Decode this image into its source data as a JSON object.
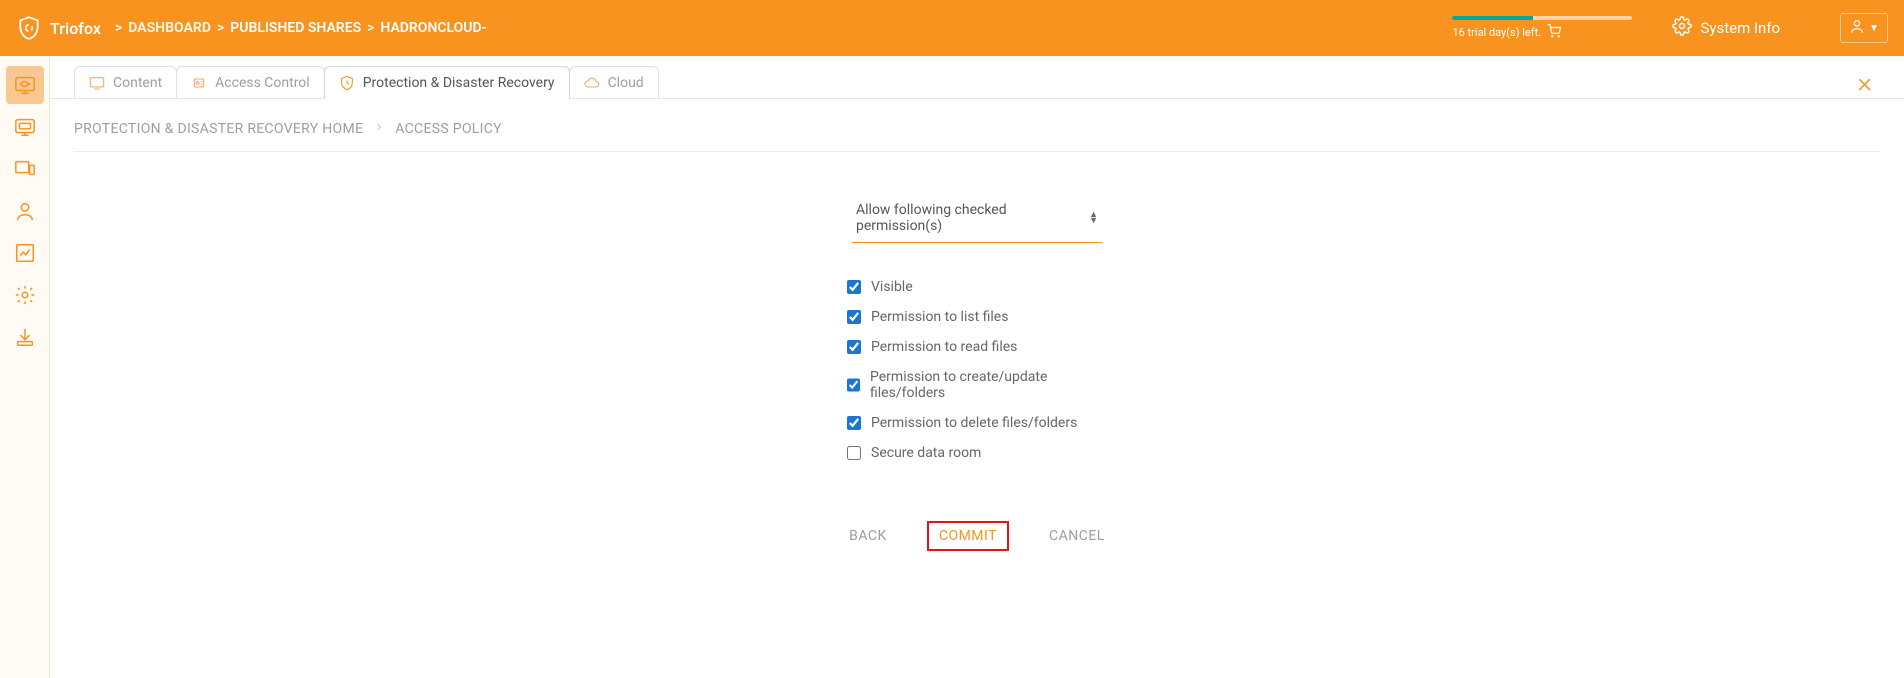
{
  "header": {
    "brand": "Triofox",
    "crumbs": {
      "dashboard": "DASHBOARD",
      "published": "PUBLISHED SHARES",
      "target": "HADRONCLOUD-"
    },
    "trial_text": "16 trial day(s) left.",
    "system_info": "System Info"
  },
  "tabs": {
    "content": "Content",
    "access": "Access Control",
    "protection": "Protection & Disaster Recovery",
    "cloud": "Cloud"
  },
  "sub_crumbs": {
    "home": "PROTECTION & DISASTER RECOVERY HOME",
    "current": "ACCESS POLICY"
  },
  "dropdown_label": "Allow following checked permission(s)",
  "permissions": [
    {
      "label": "Visible",
      "checked": true
    },
    {
      "label": "Permission to list files",
      "checked": true
    },
    {
      "label": "Permission to read files",
      "checked": true
    },
    {
      "label": "Permission to create/update files/folders",
      "checked": true
    },
    {
      "label": "Permission to delete files/folders",
      "checked": true
    },
    {
      "label": "Secure data room",
      "checked": false
    }
  ],
  "buttons": {
    "back": "BACK",
    "commit": "COMMIT",
    "cancel": "CANCEL"
  },
  "colors": {
    "accent": "#f7931e",
    "highlight_border": "#e81313"
  }
}
